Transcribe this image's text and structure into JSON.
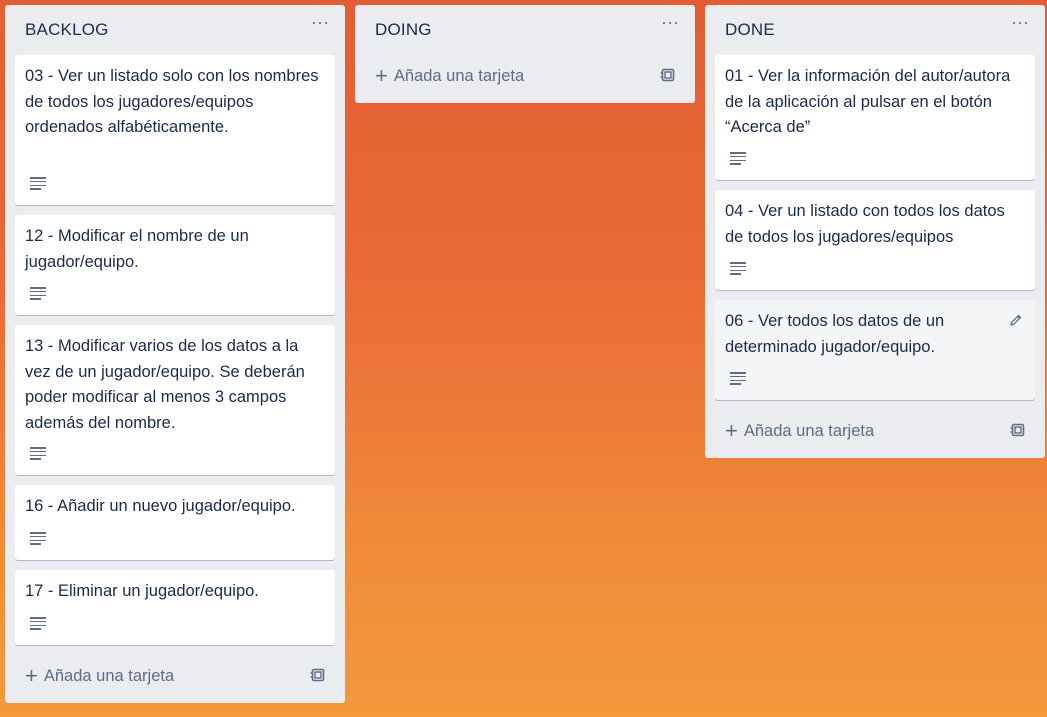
{
  "lists": [
    {
      "title": "BACKLOG",
      "menu": "···",
      "cards": [
        {
          "text": "03 - Ver un listado solo con los nombres de todos los jugadores/equipos ordenados alfabéticamente."
        },
        {
          "text": "12 - Modificar el nombre de un jugador/equipo."
        },
        {
          "text": "13 - Modificar varios de los datos a la vez de un jugador/equipo. Se deberán poder modificar al menos 3 campos además del nombre."
        },
        {
          "text": "16 - Añadir un nuevo jugador/equipo."
        },
        {
          "text": "17 - Eliminar un jugador/equipo."
        }
      ],
      "add_label": "Añada una tarjeta"
    },
    {
      "title": "DOING",
      "menu": "···",
      "cards": [],
      "add_label": "Añada una tarjeta"
    },
    {
      "title": "DONE",
      "menu": "···",
      "cards": [
        {
          "text": "01 - Ver la información del autor/autora de la aplicación al pulsar en el botón “Acerca de”"
        },
        {
          "text": "04 - Ver un listado con todos los datos de todos los jugadores/equipos"
        },
        {
          "text": "06 - Ver todos los datos de un determinado jugador/equipo."
        }
      ],
      "add_label": "Añada una tarjeta"
    }
  ],
  "icons": {
    "description": "description-icon",
    "edit": "pencil-icon",
    "add": "plus-icon",
    "template": "card-template-icon"
  },
  "colors": {
    "list_bg": "#ebecf0",
    "card_bg": "#ffffff",
    "text": "#172b4d",
    "muted": "#5e6c84",
    "board_top": "#e35d34",
    "board_bottom": "#f39a3c"
  }
}
